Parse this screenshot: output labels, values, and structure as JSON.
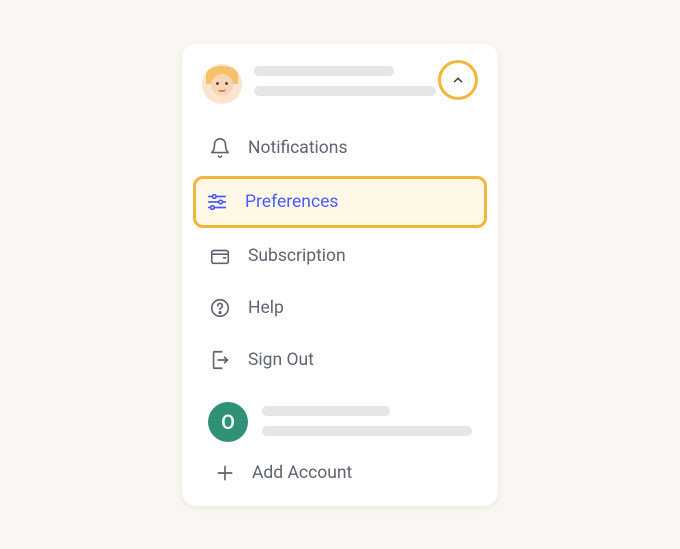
{
  "profile": {
    "avatar_placeholder": true
  },
  "collapse": {
    "direction": "up"
  },
  "menu": {
    "items": [
      {
        "icon": "bell",
        "label": "Notifications",
        "highlighted": false
      },
      {
        "icon": "sliders",
        "label": "Preferences",
        "highlighted": true
      },
      {
        "icon": "wallet",
        "label": "Subscription",
        "highlighted": false
      },
      {
        "icon": "help",
        "label": "Help",
        "highlighted": false
      },
      {
        "icon": "signout",
        "label": "Sign Out",
        "highlighted": false
      }
    ]
  },
  "secondary_account": {
    "initial": "O"
  },
  "add_account": {
    "label": "Add Account"
  },
  "colors": {
    "highlight_border": "#f3b63b",
    "highlight_bg": "#fff8e6",
    "highlight_text": "#4b5bff",
    "badge_bg": "#2f9175"
  }
}
